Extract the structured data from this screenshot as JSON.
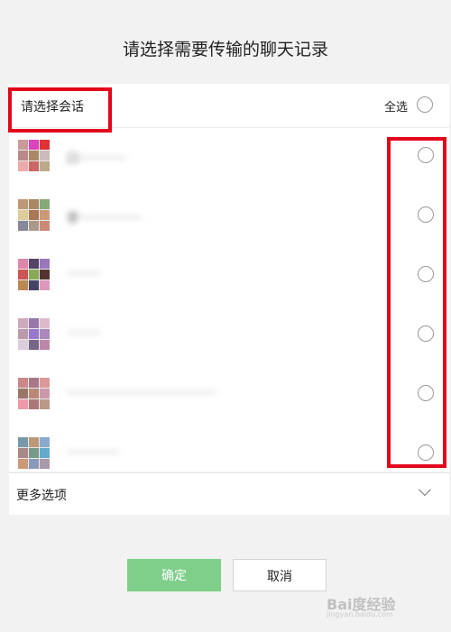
{
  "dialog": {
    "title": "请选择需要传输的聊天记录"
  },
  "list": {
    "header_label": "请选择会话",
    "select_all_label": "全选",
    "rows": [
      {
        "name": "口·············",
        "avatar_colors": [
          "#c99",
          "#d4b",
          "#d33",
          "#b88",
          "#a86",
          "#cbb",
          "#eaa",
          "#c66",
          "#ba8"
        ]
      },
      {
        "name": "苷·················",
        "avatar_colors": [
          "#b97",
          "#a86",
          "#8a7",
          "#dc9",
          "#a75",
          "#c97",
          "#889",
          "#a98",
          "#c87"
        ]
      },
      {
        "name": "·········",
        "avatar_colors": [
          "#d8a",
          "#546",
          "#97b",
          "#c55",
          "#8a5",
          "#533",
          "#b85",
          "#446",
          "#d9b"
        ]
      },
      {
        "name": "·········",
        "avatar_colors": [
          "#cab",
          "#97a",
          "#dbc",
          "#b9a",
          "#97c",
          "#a8b",
          "#dcd",
          "#768",
          "#b8a"
        ]
      },
      {
        "name": "········································",
        "avatar_colors": [
          "#c88",
          "#a78",
          "#d99",
          "#976",
          "#b87",
          "#c9a",
          "#e9a",
          "#a77",
          "#b98"
        ]
      },
      {
        "name": "··············",
        "avatar_colors": [
          "#79a",
          "#b97",
          "#8ac",
          "#a88",
          "#798",
          "#6ac",
          "#c97",
          "#89b",
          "#a9a"
        ]
      }
    ]
  },
  "more_options": {
    "label": "更多选项"
  },
  "buttons": {
    "confirm_label": "确定",
    "cancel_label": "取消"
  },
  "watermark": {
    "text": "Bai度经验",
    "sub": "jingyan.baidu.com"
  },
  "colors": {
    "confirm_green": "#7fcf8a",
    "highlight_red": "#e3061a"
  }
}
